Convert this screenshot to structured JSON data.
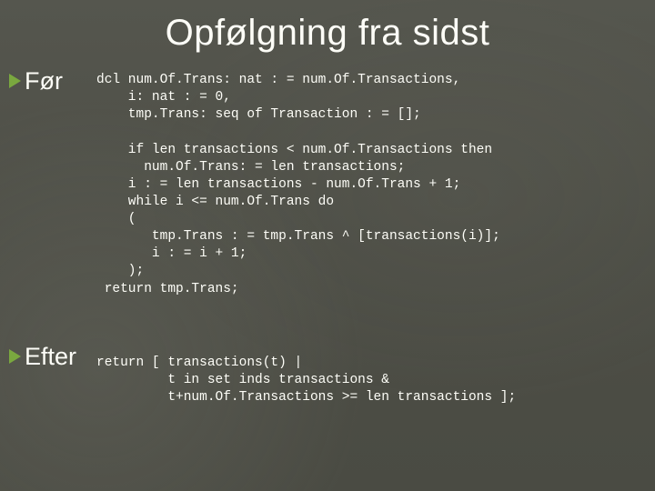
{
  "title": "Opfølgning fra sidst",
  "sections": {
    "before": {
      "label": "Før",
      "code": "dcl num.Of.Trans: nat : = num.Of.Transactions,\n    i: nat : = 0,\n    tmp.Trans: seq of Transaction : = [];\n\n    if len transactions < num.Of.Transactions then\n      num.Of.Trans: = len transactions;\n    i : = len transactions - num.Of.Trans + 1;\n    while i <= num.Of.Trans do\n    (\n       tmp.Trans : = tmp.Trans ^ [transactions(i)];\n       i : = i + 1;\n    );\n return tmp.Trans;"
    },
    "after": {
      "label": "Efter",
      "code": "return [ transactions(t) |\n         t in set inds transactions &\n         t+num.Of.Transactions >= len transactions ];"
    }
  }
}
